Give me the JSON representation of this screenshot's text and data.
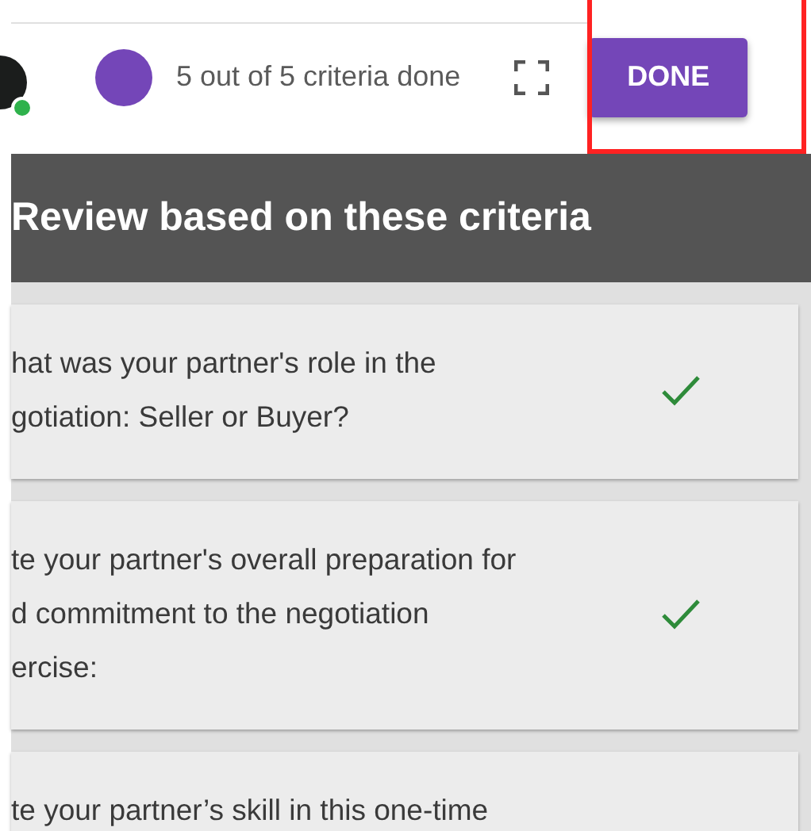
{
  "top_bar": {
    "progress": "5 out of 5 criteria done",
    "done_button": "DONE",
    "highlighted": true
  },
  "header": {
    "title": "Review based on these criteria"
  },
  "criteria": [
    {
      "lines": [
        "hat was your partner's role in the",
        "gotiation: Seller or Buyer?"
      ],
      "done": true
    },
    {
      "lines": [
        "te your partner's overall preparation for",
        "d commitment to the negotiation",
        "ercise:"
      ],
      "done": true
    },
    {
      "lines": [
        "te your partner’s skill in this one-time"
      ]
    }
  ]
}
